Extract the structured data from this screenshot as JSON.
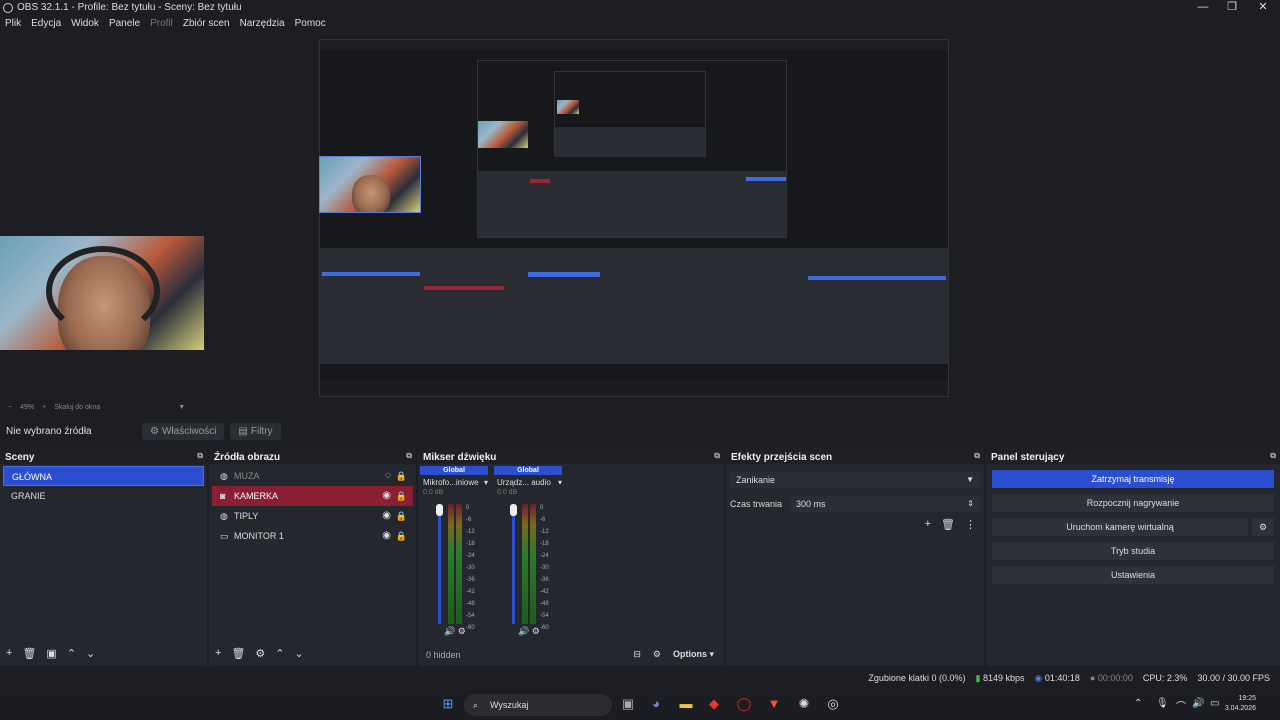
{
  "window": {
    "title": "OBS 32.1.1 - Profile: Bez tytułu - Sceny: Bez tytułu",
    "controls": [
      "—",
      "❐",
      "✕"
    ]
  },
  "menu": {
    "items": [
      "Plik",
      "Edycja",
      "Widok",
      "Panele",
      "Profil",
      "Zbiór scen",
      "Narzędzia",
      "Pomoc"
    ]
  },
  "preview": {
    "zoom": "49%",
    "scale_label": "Skaluj do okna"
  },
  "source_toolbar": {
    "no_source": "Nie wybrano źródła",
    "properties": "Właściwości",
    "filters": "Filtry"
  },
  "scenes": {
    "title": "Sceny",
    "items": [
      "GŁÓWNA",
      "GRANIE"
    ],
    "selected": 0
  },
  "sources": {
    "title": "Źródła obrazu",
    "items": [
      {
        "name": "MUZA",
        "icon": "globe-icon",
        "state": "hidden"
      },
      {
        "name": "KAMERKA",
        "icon": "camera-icon",
        "state": "selected"
      },
      {
        "name": "TIPLY",
        "icon": "globe-icon",
        "state": "visible"
      },
      {
        "name": "MONITOR 1",
        "icon": "monitor-icon",
        "state": "visible"
      }
    ]
  },
  "mixer": {
    "title": "Mikser dźwięku",
    "channels": [
      {
        "tag": "Global",
        "name": "Mikrofo...iniowe",
        "db": "0.0 dB",
        "level": 0.38
      },
      {
        "tag": "Global",
        "name": "Urządz... audio",
        "db": "0.0 dB",
        "level": 0.34
      }
    ],
    "scale": [
      "0",
      "-6",
      "-12",
      "-18",
      "-24",
      "-30",
      "-36",
      "-42",
      "-48",
      "-54",
      "-60"
    ],
    "hidden": "0 hidden",
    "options": "Options"
  },
  "transitions": {
    "title": "Efekty przejścia scen",
    "type": "Zanikanie",
    "duration_label": "Czas trwania",
    "duration_value": "300 ms"
  },
  "controls": {
    "title": "Panel sterujący",
    "buttons": [
      "Zatrzymaj transmisję",
      "Rozpocznij nagrywanie",
      "Uruchom kamerę wirtualną",
      "Tryb studia",
      "Ustawienia"
    ]
  },
  "status": {
    "dropped": "Zgubione klatki 0 (0.0%)",
    "bitrate": "8149 kbps",
    "stream_time": "01:40:18",
    "rec_time": "00:00:00",
    "cpu": "CPU: 2.3%",
    "fps": "30.00 / 30.00 FPS"
  },
  "taskbar": {
    "search": "Wyszukaj",
    "time": "19:25",
    "date": "3.04.2026"
  },
  "colors": {
    "accent": "#2c4fd0",
    "selected_source": "#8a1f33",
    "bg": "#1d1e24",
    "dock": "#25272e"
  }
}
